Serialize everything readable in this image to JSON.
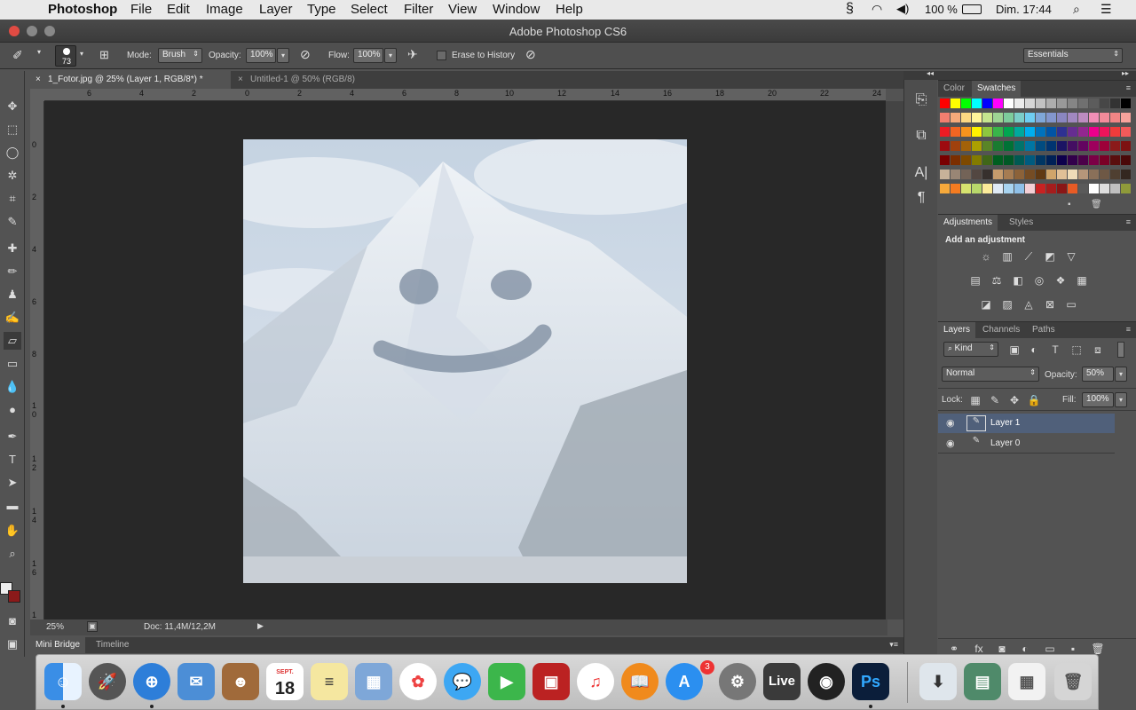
{
  "menubar": {
    "apple_icon": "apple-icon",
    "app_name": "Photoshop",
    "items": [
      "File",
      "Edit",
      "Image",
      "Layer",
      "Type",
      "Select",
      "Filter",
      "View",
      "Window",
      "Help"
    ],
    "battery": "100 %",
    "clock": "Dim. 17:44"
  },
  "titlebar": {
    "title": "Adobe Photoshop CS6"
  },
  "options": {
    "brush_size": "73",
    "mode_label": "Mode:",
    "mode_value": "Brush",
    "opacity_label": "Opacity:",
    "opacity_value": "100%",
    "flow_label": "Flow:",
    "flow_value": "100%",
    "erase_history": "Erase to History",
    "workspace": "Essentials"
  },
  "doc_tabs": [
    {
      "label": "1_Fotor.jpg @ 25% (Layer 1, RGB/8*) *",
      "active": true
    },
    {
      "label": "Untitled-1 @ 50% (RGB/8)",
      "active": false
    }
  ],
  "hruler": [
    "6",
    "4",
    "2",
    "0",
    "2",
    "4",
    "6",
    "8",
    "10",
    "12",
    "14",
    "16",
    "18",
    "20",
    "22",
    "24"
  ],
  "vruler": [
    "0",
    "2",
    "4",
    "6",
    "8",
    "1 0",
    "1 2",
    "1 4",
    "1 6",
    "1"
  ],
  "status": {
    "zoom": "25%",
    "doc": "Doc: 11,4M/12,2M"
  },
  "bottom_tabs": [
    "Mini Bridge",
    "Timeline"
  ],
  "color_panel": {
    "tabs": [
      "Color",
      "Swatches"
    ]
  },
  "adjust_panel": {
    "tabs": [
      "Adjustments",
      "Styles"
    ],
    "heading": "Add an adjustment"
  },
  "layers_panel": {
    "tabs": [
      "Layers",
      "Channels",
      "Paths"
    ],
    "kind": "Kind",
    "blend": "Normal",
    "opacity_label": "Opacity:",
    "opacity_value": "50%",
    "lock_label": "Lock:",
    "fill_label": "Fill:",
    "fill_value": "100%",
    "layers": [
      {
        "name": "Layer 1",
        "selected": true
      },
      {
        "name": "Layer 0",
        "selected": false
      }
    ]
  },
  "dock": {
    "calendar_month": "SEPT.",
    "calendar_day": "18",
    "appstore_badge": "3",
    "live_label": "Live",
    "ps_label": "Ps"
  },
  "colors": {
    "accent_selected_layer": "#50607a",
    "canvas_bg": "#282828",
    "panel_bg": "#535353"
  }
}
